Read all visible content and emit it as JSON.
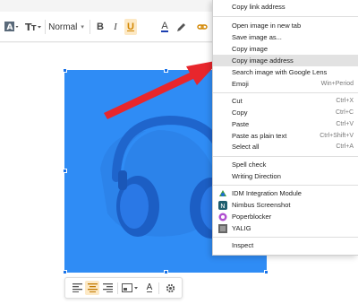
{
  "toolbar": {
    "paragraph_style": "Normal",
    "bold": "B",
    "italic": "I",
    "underline": "U",
    "font_color": "A",
    "highlight_color": "#d28600"
  },
  "image": {
    "subject": "headphones",
    "background_color": "#2f8cf5"
  },
  "image_toolbar": {
    "align_left": "align-left-icon",
    "align_center": "align-center-icon",
    "align_right": "align-right-icon",
    "image_size": "image-size-icon",
    "alt_text": "A",
    "settings": "gear-icon",
    "active_color": "#fde9c5"
  },
  "context_menu": {
    "items": [
      {
        "label": "Copy link address",
        "shortcut": ""
      },
      {
        "label": "Open image in new tab",
        "shortcut": ""
      },
      {
        "label": "Save image as...",
        "shortcut": ""
      },
      {
        "label": "Copy image",
        "shortcut": ""
      },
      {
        "label": "Copy image address",
        "shortcut": "",
        "highlighted": true
      },
      {
        "label": "Search image with Google Lens",
        "shortcut": ""
      },
      {
        "label": "Emoji",
        "shortcut": "Win+Period"
      },
      {
        "label": "Cut",
        "shortcut": "Ctrl+X"
      },
      {
        "label": "Copy",
        "shortcut": "Ctrl+C"
      },
      {
        "label": "Paste",
        "shortcut": "Ctrl+V"
      },
      {
        "label": "Paste as plain text",
        "shortcut": "Ctrl+Shift+V"
      },
      {
        "label": "Select all",
        "shortcut": "Ctrl+A"
      },
      {
        "label": "Spell check",
        "shortcut": ""
      },
      {
        "label": "Writing Direction",
        "shortcut": ""
      },
      {
        "label": "IDM Integration Module",
        "shortcut": ""
      },
      {
        "label": "Nimbus Screenshot",
        "shortcut": ""
      },
      {
        "label": "Poperblocker",
        "shortcut": ""
      },
      {
        "label": "YALIG",
        "shortcut": ""
      },
      {
        "label": "Inspect",
        "shortcut": ""
      }
    ]
  },
  "annotation": {
    "arrow_color": "#e8262c"
  }
}
